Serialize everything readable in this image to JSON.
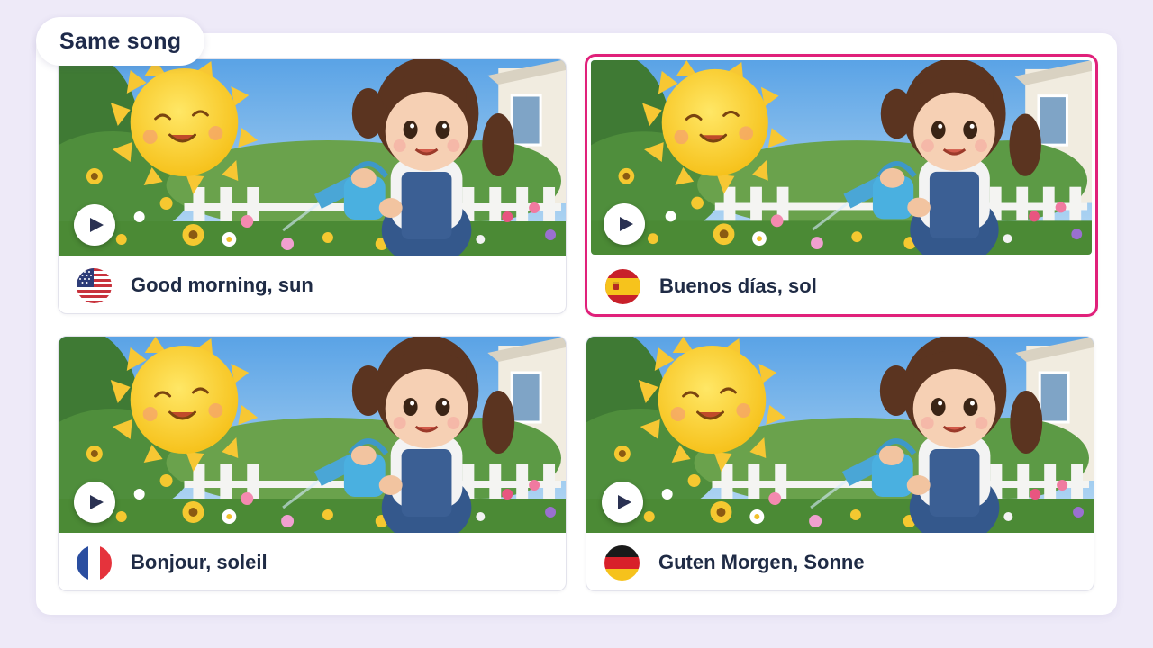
{
  "header": {
    "tag_label": "Same song"
  },
  "cards": [
    {
      "title": "Good morning, sun",
      "flag_icon": "us-flag-icon",
      "language": "English",
      "selected": false
    },
    {
      "title": "Buenos días, sol",
      "flag_icon": "spain-flag-icon",
      "language": "Spanish",
      "selected": true
    },
    {
      "title": "Bonjour, soleil",
      "flag_icon": "france-flag-icon",
      "language": "French",
      "selected": false
    },
    {
      "title": "Guten Morgen, Sonne",
      "flag_icon": "germany-flag-icon",
      "language": "German",
      "selected": false
    }
  ],
  "colors": {
    "accent": "#e0207a",
    "background": "#eeeaf8",
    "text": "#1f2b45"
  }
}
